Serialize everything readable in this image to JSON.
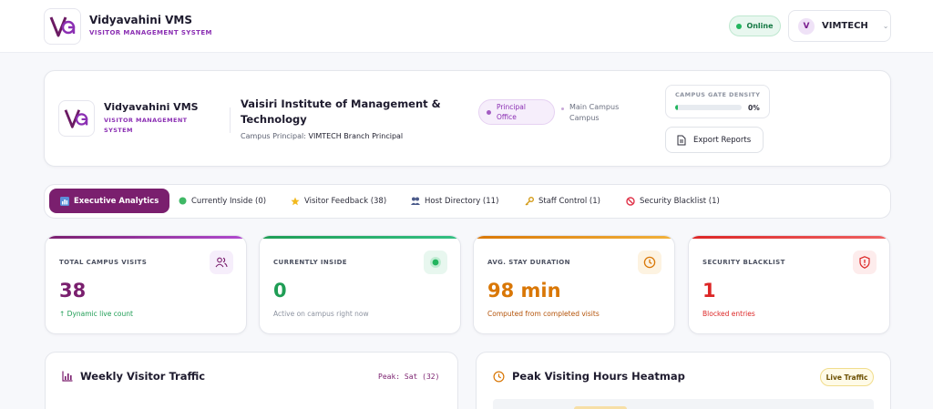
{
  "brand": {
    "name": "Vidyavahini VMS",
    "subtitle": "VISITOR MANAGEMENT SYSTEM",
    "header_subtitle_line1": "VISITOR MANAGEMENT",
    "header_subtitle_line2": "SYSTEM"
  },
  "status": {
    "label": "Online",
    "color": "#22b55e"
  },
  "user": {
    "initial": "V",
    "name": "VIMTECH"
  },
  "institution": {
    "name": "Vaisiri Institute of Management & Technology",
    "principal_label": "Campus Principal:",
    "principal_name": "VIMTECH Branch Principal",
    "office_line1": "Principal",
    "office_line2": "Office",
    "campus_line1": "Main Campus",
    "campus_line2": "Campus"
  },
  "density": {
    "label": "CAMPUS GATE DENSITY",
    "percent_label": "0%",
    "fraction": 0.0
  },
  "export_label": "Export Reports",
  "tabs": [
    {
      "label": "Executive Analytics",
      "icon": "bar-chart-icon"
    },
    {
      "label": "Currently Inside (0)",
      "icon": "green-dot-icon"
    },
    {
      "label": "Visitor Feedback (38)",
      "icon": "star-icon"
    },
    {
      "label": "Host Directory (11)",
      "icon": "people-icon"
    },
    {
      "label": "Staff Control (1)",
      "icon": "key-icon"
    },
    {
      "label": "Security Blacklist (1)",
      "icon": "no-entry-icon"
    }
  ],
  "stats": [
    {
      "label": "TOTAL CAMPUS VISITS",
      "value": "38",
      "sub": "↑ Dynamic live count",
      "color": "#7a1f6e",
      "sub_color": "#1f9d55",
      "icon": "users-icon"
    },
    {
      "label": "CURRENTLY INSIDE",
      "value": "0",
      "sub": "Active on campus right now",
      "color": "#1f9d55",
      "sub_color": "#8d93a0",
      "icon": "live-dot-icon"
    },
    {
      "label": "AVG. STAY DURATION",
      "value": "98 min",
      "sub": "Computed from completed visits",
      "color": "#d97706",
      "sub_color": "#b45309",
      "icon": "clock-icon"
    },
    {
      "label": "SECURITY BLACKLIST",
      "value": "1",
      "sub": "Blocked entries",
      "color": "#dc2626",
      "sub_color": "#dc2626",
      "icon": "shield-alert-icon"
    }
  ],
  "traffic": {
    "title": "Weekly Visitor Traffic",
    "peak": "Peak: Sat (32)"
  },
  "heatmap": {
    "title": "Peak Visiting Hours Heatmap",
    "badge": "Live Traffic"
  },
  "colors": {
    "brand": "#7a1f6e",
    "accent_purple": "#8b2fb3"
  }
}
